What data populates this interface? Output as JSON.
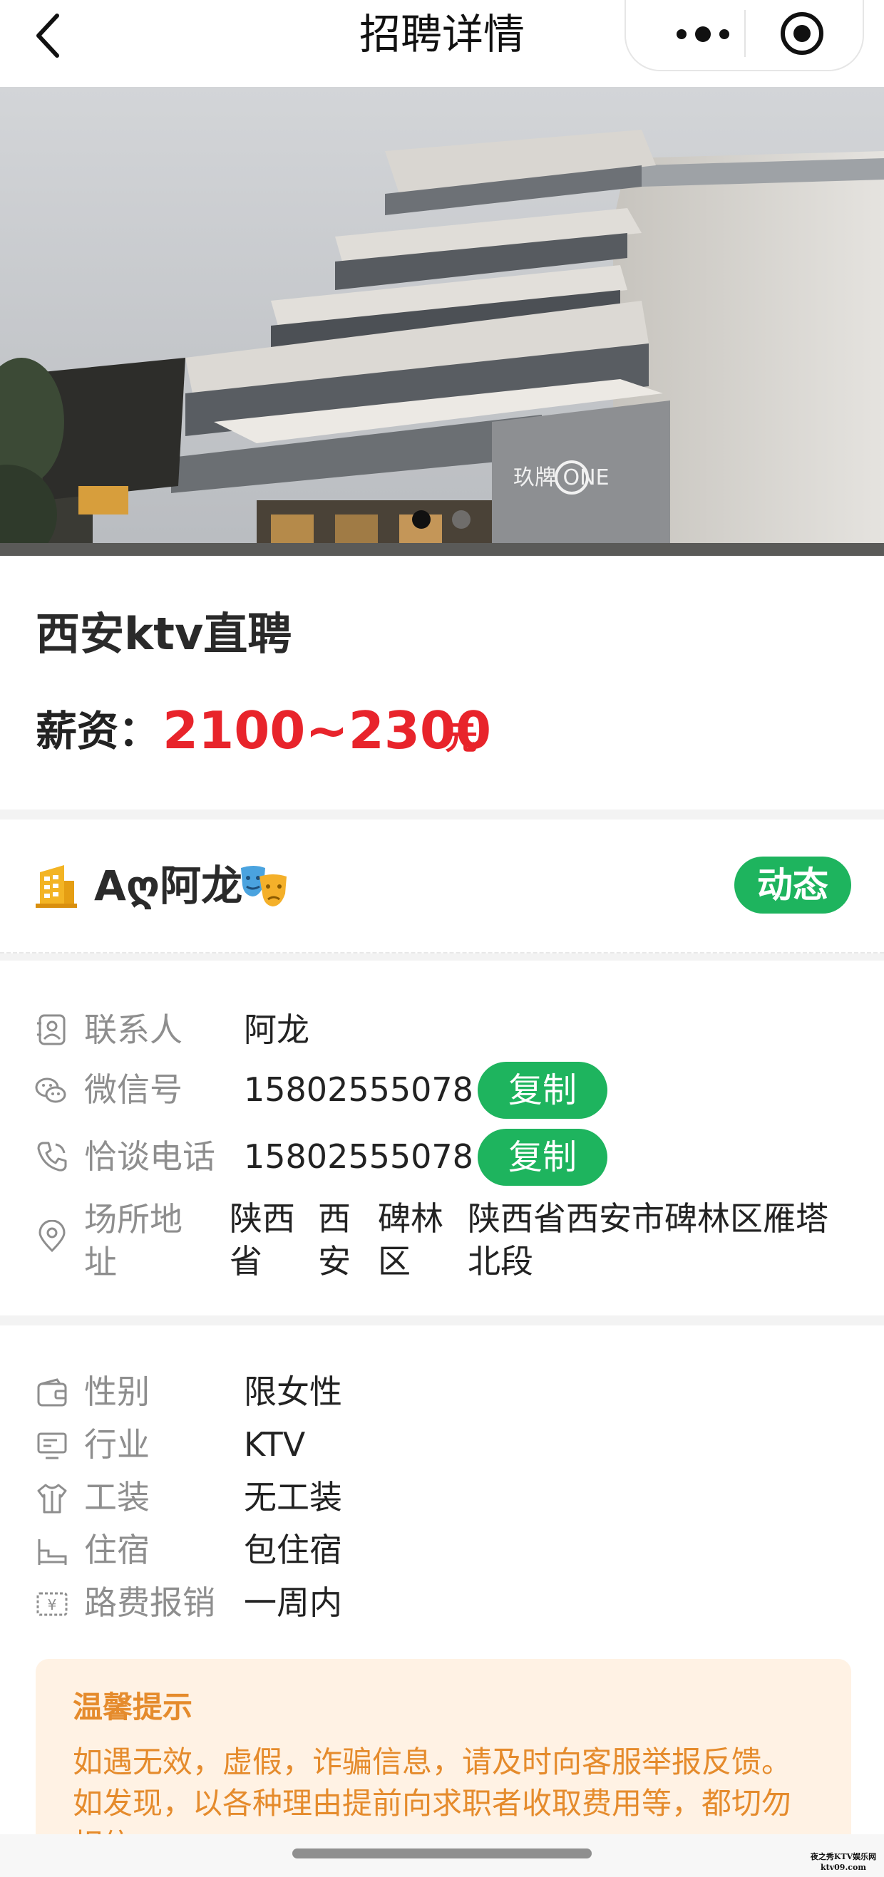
{
  "nav": {
    "title": "招聘详情",
    "back_icon": "chevron-left-icon",
    "more_icon": "more-dots-icon",
    "close_icon": "target-circle-icon"
  },
  "hero": {
    "signage": "玖牌 ONE",
    "slide_count": 2,
    "active_slide": 1
  },
  "job": {
    "title": "西安ktv直聘",
    "salary_label": "薪资：",
    "salary_value": "2100~2300",
    "salary_unit": "元"
  },
  "company": {
    "name": "Aღ阿龙",
    "emoji": "🎭",
    "dynamic_label": "动态"
  },
  "contact": {
    "contact_person_label": "联系人",
    "contact_person": "阿龙",
    "wechat_label": "微信号",
    "wechat": "15802555078",
    "phone_label": "恰谈电话",
    "phone": "15802555078",
    "copy_label": "复制",
    "address_label_line1": "场所地",
    "address_label_line2": "址",
    "province_line1": "陕西",
    "province_line2": "省",
    "city_line1": "西",
    "city_line2": "安",
    "district_line1": "碑林",
    "district_line2": "区",
    "address_line1": "陕西省西安市碑林区雁塔",
    "address_line2": "北段"
  },
  "details": [
    {
      "label": "性别",
      "value": "限女性",
      "icon": "wallet-icon"
    },
    {
      "label": "行业",
      "value": "KTV",
      "icon": "monitor-icon"
    },
    {
      "label": "工装",
      "value": "无工装",
      "icon": "shirt-icon"
    },
    {
      "label": "住宿",
      "value": "包住宿",
      "icon": "bed-icon"
    },
    {
      "label": "路费报销",
      "value": "一周内",
      "icon": "money-icon"
    }
  ],
  "tip": {
    "title": "温馨提示",
    "line1": "如遇无效，虚假，诈骗信息，请及时向客服举报反馈。",
    "line2": "如发现，以各种理由提前向求职者收取费用等，都切勿",
    "line3": "相信。"
  },
  "watermark": {
    "line1": "夜之秀KTV娱乐网",
    "line2": "ktv09.com"
  },
  "colors": {
    "accent_green": "#1eb45e",
    "salary_red": "#e8242b",
    "tip_orange": "#e58b2c",
    "tip_bg": "#fff2e4"
  }
}
